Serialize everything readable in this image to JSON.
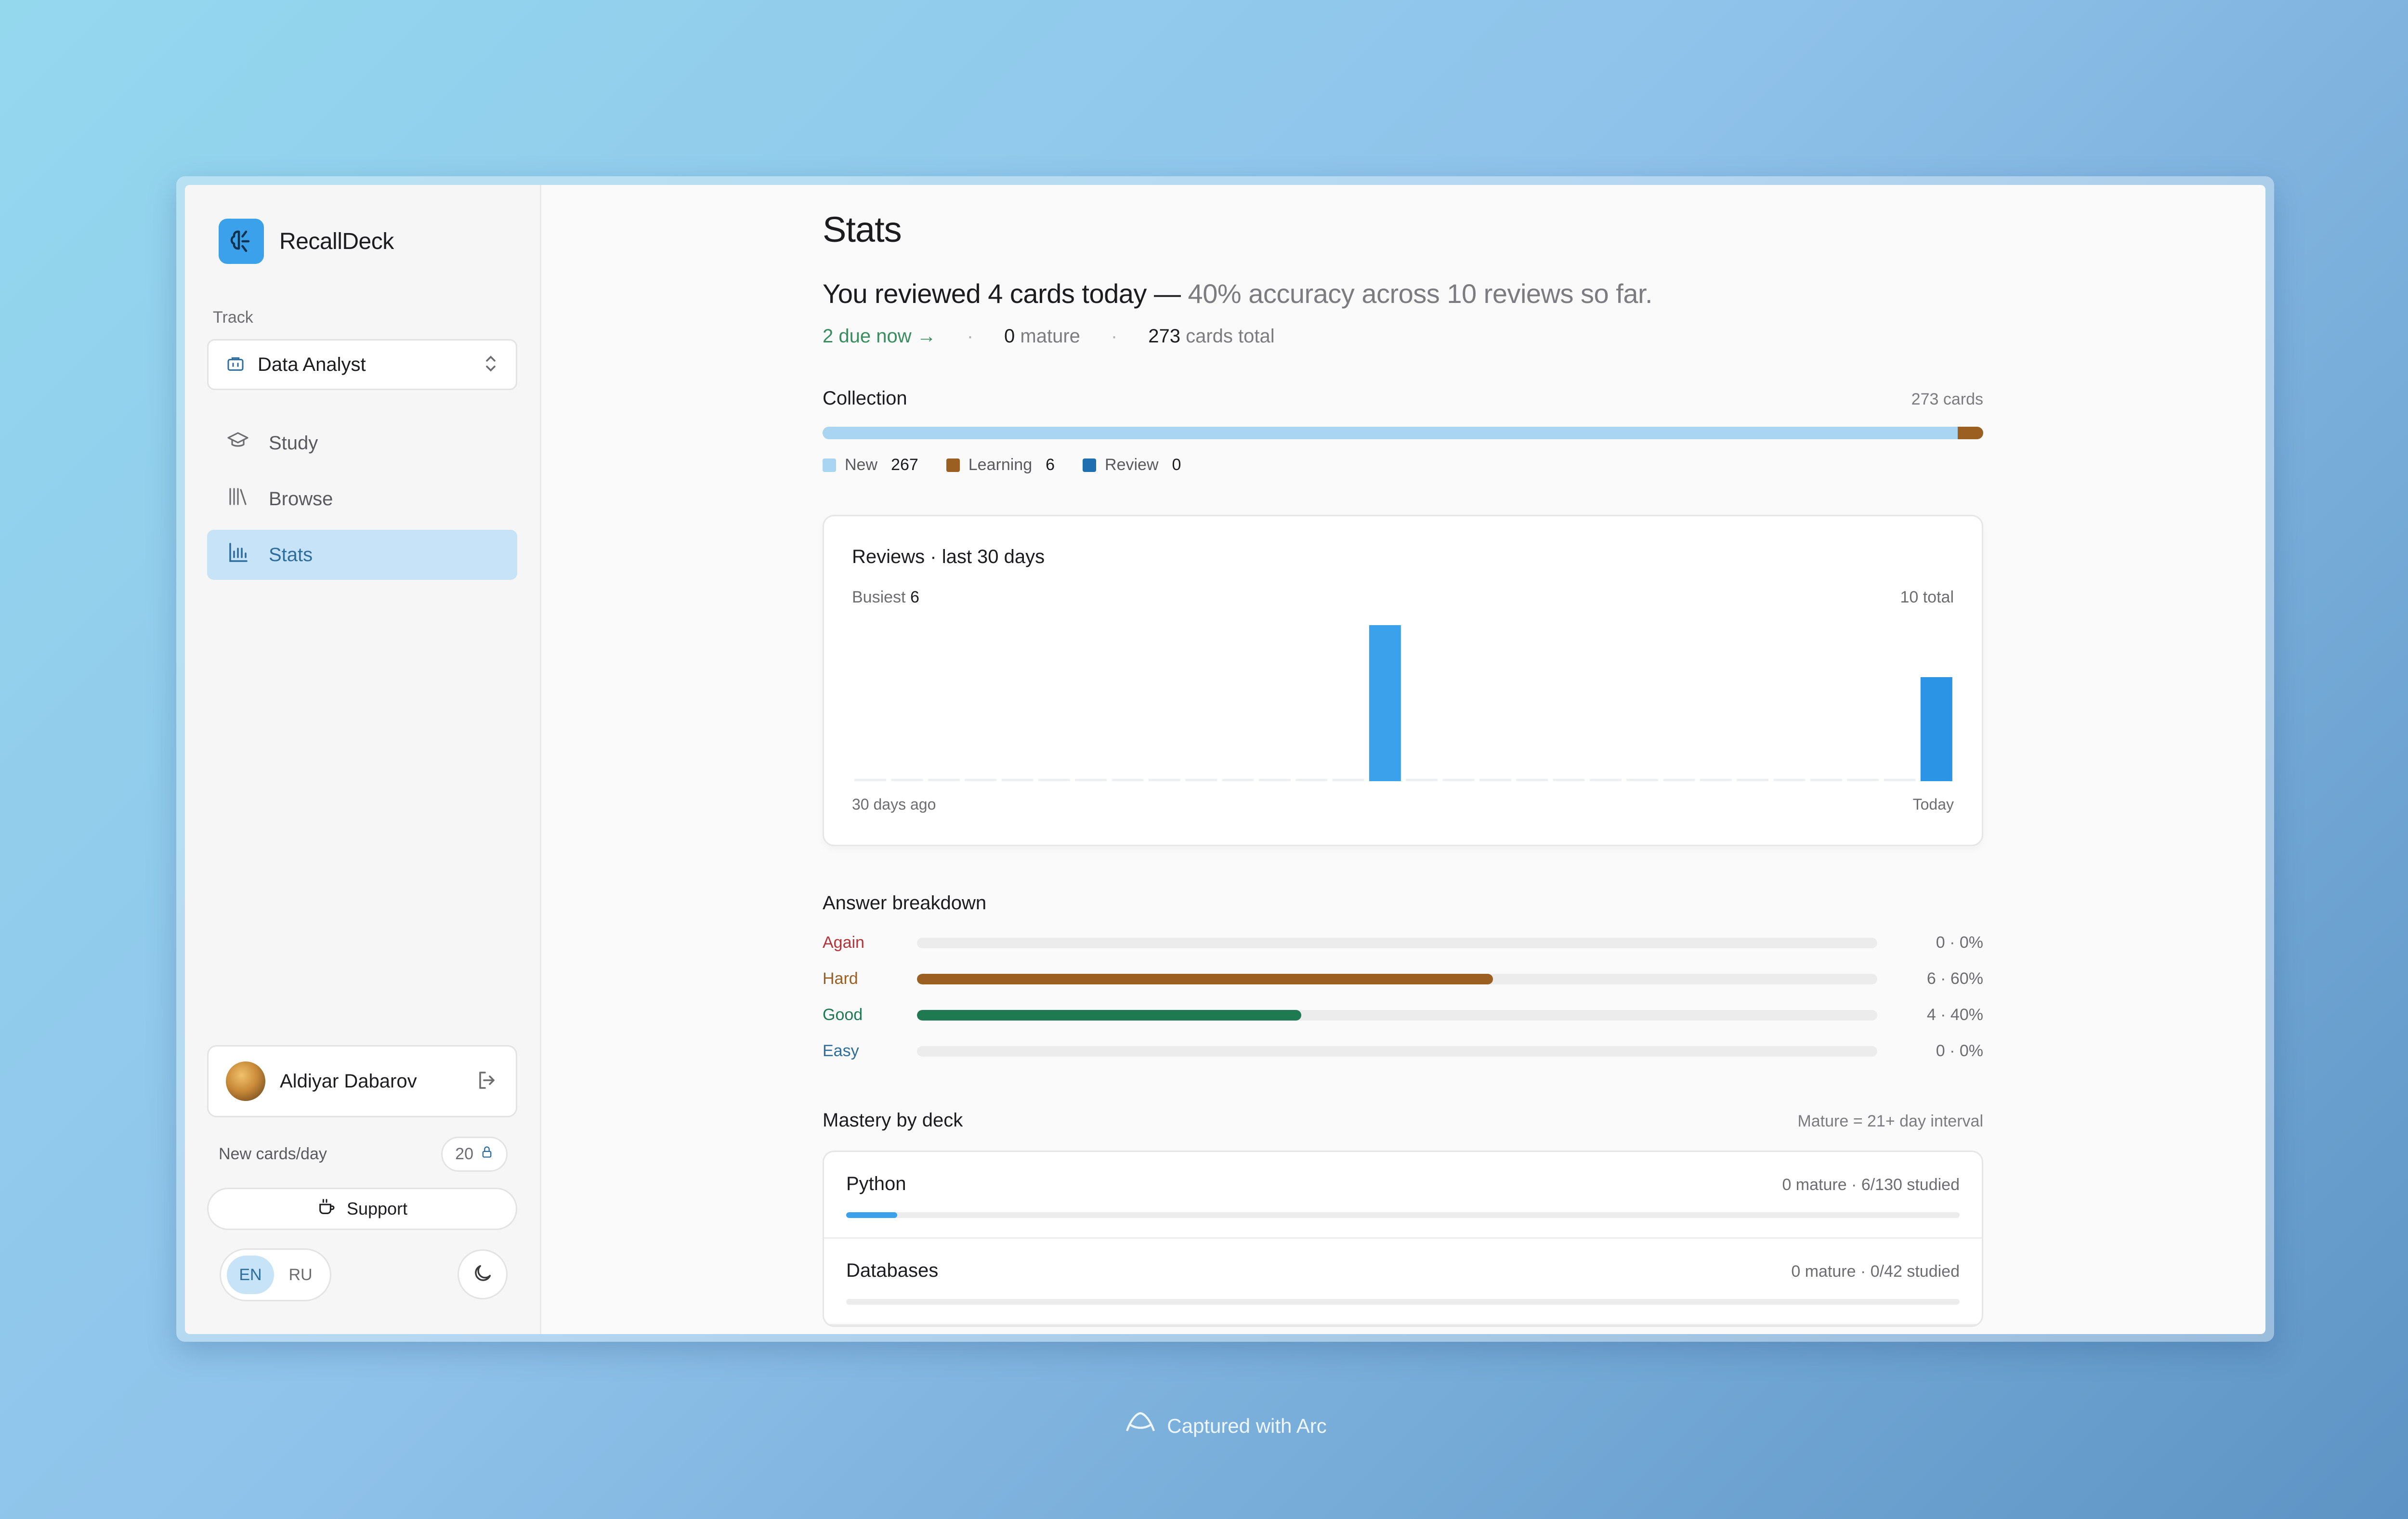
{
  "app": {
    "name": "RecallDeck"
  },
  "sidebar": {
    "track_label": "Track",
    "track_value": "Data Analyst",
    "nav": [
      {
        "label": "Study",
        "icon": "graduation-cap-icon",
        "active": false
      },
      {
        "label": "Browse",
        "icon": "library-icon",
        "active": false
      },
      {
        "label": "Stats",
        "icon": "bar-chart-icon",
        "active": true
      }
    ],
    "user_name": "Aldiyar Dabarov",
    "new_cards_label": "New cards/day",
    "new_cards_value": "20",
    "support_label": "Support",
    "languages": [
      {
        "code": "EN",
        "active": true
      },
      {
        "code": "RU",
        "active": false
      }
    ]
  },
  "main": {
    "title": "Stats",
    "headline_main": "You reviewed 4 cards today —",
    "headline_muted": "40% accuracy across 10 reviews so far.",
    "due_now": "2 due now →",
    "mature_count": "0",
    "mature_label": "mature",
    "total_count": "273",
    "total_label": "cards total",
    "collection": {
      "title": "Collection",
      "count_label": "273 cards",
      "segments": [
        {
          "name": "New",
          "value": 267,
          "color": "#a9d5f2"
        },
        {
          "name": "Learning",
          "value": 6,
          "color": "#9b5f22"
        },
        {
          "name": "Review",
          "value": 0,
          "color": "#1f6fb0"
        }
      ]
    },
    "reviews": {
      "title": "Reviews · last 30 days",
      "busiest_label": "Busiest",
      "busiest_value": "6",
      "total_label": "10 total",
      "start_label": "30 days ago",
      "end_label": "Today"
    },
    "answers": {
      "title": "Answer breakdown",
      "rows": [
        {
          "label": "Again",
          "value_label": "0 · 0%",
          "fraction": 0,
          "color": "#b3353a",
          "fill": "#b3353a"
        },
        {
          "label": "Hard",
          "value_label": "6 · 60%",
          "fraction": 0.6,
          "color": "#9b5f22",
          "fill": "#9b5f22"
        },
        {
          "label": "Good",
          "value_label": "4 · 40%",
          "fraction": 0.4,
          "color": "#1f7a52",
          "fill": "#1f7a52"
        },
        {
          "label": "Easy",
          "value_label": "0 · 0%",
          "fraction": 0,
          "color": "#2e6d9c",
          "fill": "#2e6d9c"
        }
      ]
    },
    "mastery": {
      "title": "Mastery by deck",
      "note": "Mature = 21+ day interval",
      "decks": [
        {
          "name": "Python",
          "meta": "0 mature · 6/130 studied",
          "fraction": 0.046
        },
        {
          "name": "Databases",
          "meta": "0 mature · 0/42 studied",
          "fraction": 0
        }
      ]
    }
  },
  "chart_data": {
    "type": "bar",
    "x": [
      -29,
      -28,
      -27,
      -26,
      -25,
      -24,
      -23,
      -22,
      -21,
      -20,
      -19,
      -18,
      -17,
      -16,
      -15,
      -14,
      -13,
      -12,
      -11,
      -10,
      -9,
      -8,
      -7,
      -6,
      -5,
      -4,
      -3,
      -2,
      -1,
      0
    ],
    "values": [
      0,
      0,
      0,
      0,
      0,
      0,
      0,
      0,
      0,
      0,
      0,
      0,
      0,
      0,
      6,
      0,
      0,
      0,
      0,
      0,
      0,
      0,
      0,
      0,
      0,
      0,
      0,
      0,
      0,
      4
    ],
    "ylim": [
      0,
      6
    ],
    "series": [
      {
        "name": "Reviews",
        "color": "#3aa1ea"
      }
    ]
  },
  "footer": {
    "text": "Captured with Arc"
  }
}
